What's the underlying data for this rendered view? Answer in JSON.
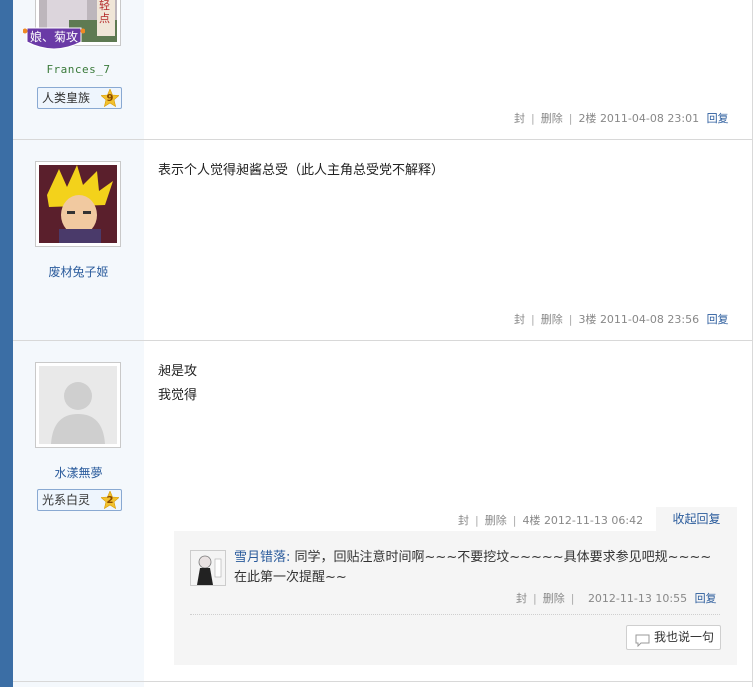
{
  "posts": [
    {
      "username": "Frances_7",
      "sticker_text": "娘、菊攻",
      "avatar_text": "你轻点",
      "badge": {
        "label": "人类皇族",
        "level": "9"
      },
      "meta": {
        "ban": "封",
        "delete": "删除",
        "floor": "2楼",
        "time": "2011-04-08 23:01",
        "reply": "回复"
      }
    },
    {
      "username": "废材兔子姬",
      "content": "表示个人觉得昶酱总受（此人主角总受党不解释）",
      "meta": {
        "ban": "封",
        "delete": "删除",
        "floor": "3楼",
        "time": "2011-04-08 23:56",
        "reply": "回复"
      }
    },
    {
      "username": "水漾無夢",
      "badge": {
        "label": "光系白灵",
        "level": "2"
      },
      "content_lines": [
        "昶是攻",
        "我觉得"
      ],
      "meta": {
        "ban": "封",
        "delete": "删除",
        "floor": "4楼",
        "time": "2012-11-13 06:42",
        "reply": "收起回复"
      },
      "sub_reply": {
        "author": "雪月错落:",
        "text": "同学，回贴注意时间啊~~~不要挖坟~~~~~具体要求参见吧规~~~~在此第一次提醒~~",
        "ban": "封",
        "delete": "删除",
        "time": "2012-11-13 10:55",
        "reply": "回复"
      },
      "say_button": "我也说一句"
    }
  ],
  "separator": "|",
  "colors": {
    "left_bar": "#3b6ea5",
    "link": "#2a5b9c",
    "side_bg": "#f4f8fc",
    "sticker": "#6a3aa6"
  }
}
